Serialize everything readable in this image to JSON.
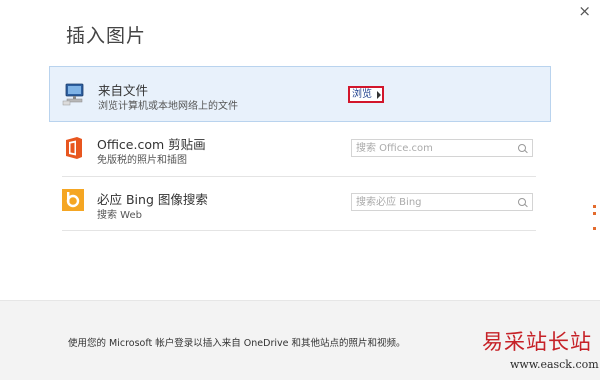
{
  "dialog": {
    "title": "插入图片",
    "close_glyph": "×"
  },
  "sources": [
    {
      "name": "来自文件",
      "description": "浏览计算机或本地网络上的文件",
      "action_label": "浏览",
      "icon": "computer-icon"
    },
    {
      "name": "Office.com 剪贴画",
      "description": "免版税的照片和插图",
      "search_placeholder": "搜索 Office.com",
      "icon": "office-icon"
    },
    {
      "name": "必应 Bing 图像搜索",
      "description": "搜索 Web",
      "search_placeholder": "搜索必应 Bing",
      "icon": "bing-icon"
    }
  ],
  "footer": {
    "text": "使用您的 Microsoft 帐户登录以插入来自 OneDrive 和其他站点的照片和视频。"
  },
  "watermark": {
    "name": "易采站长站",
    "url": "www.easck.com"
  },
  "colors": {
    "selected_bg": "#e8f1fb",
    "highlight_border": "#d2162b",
    "office_orange": "#e8561f",
    "bing_yellow": "#f5a623"
  }
}
